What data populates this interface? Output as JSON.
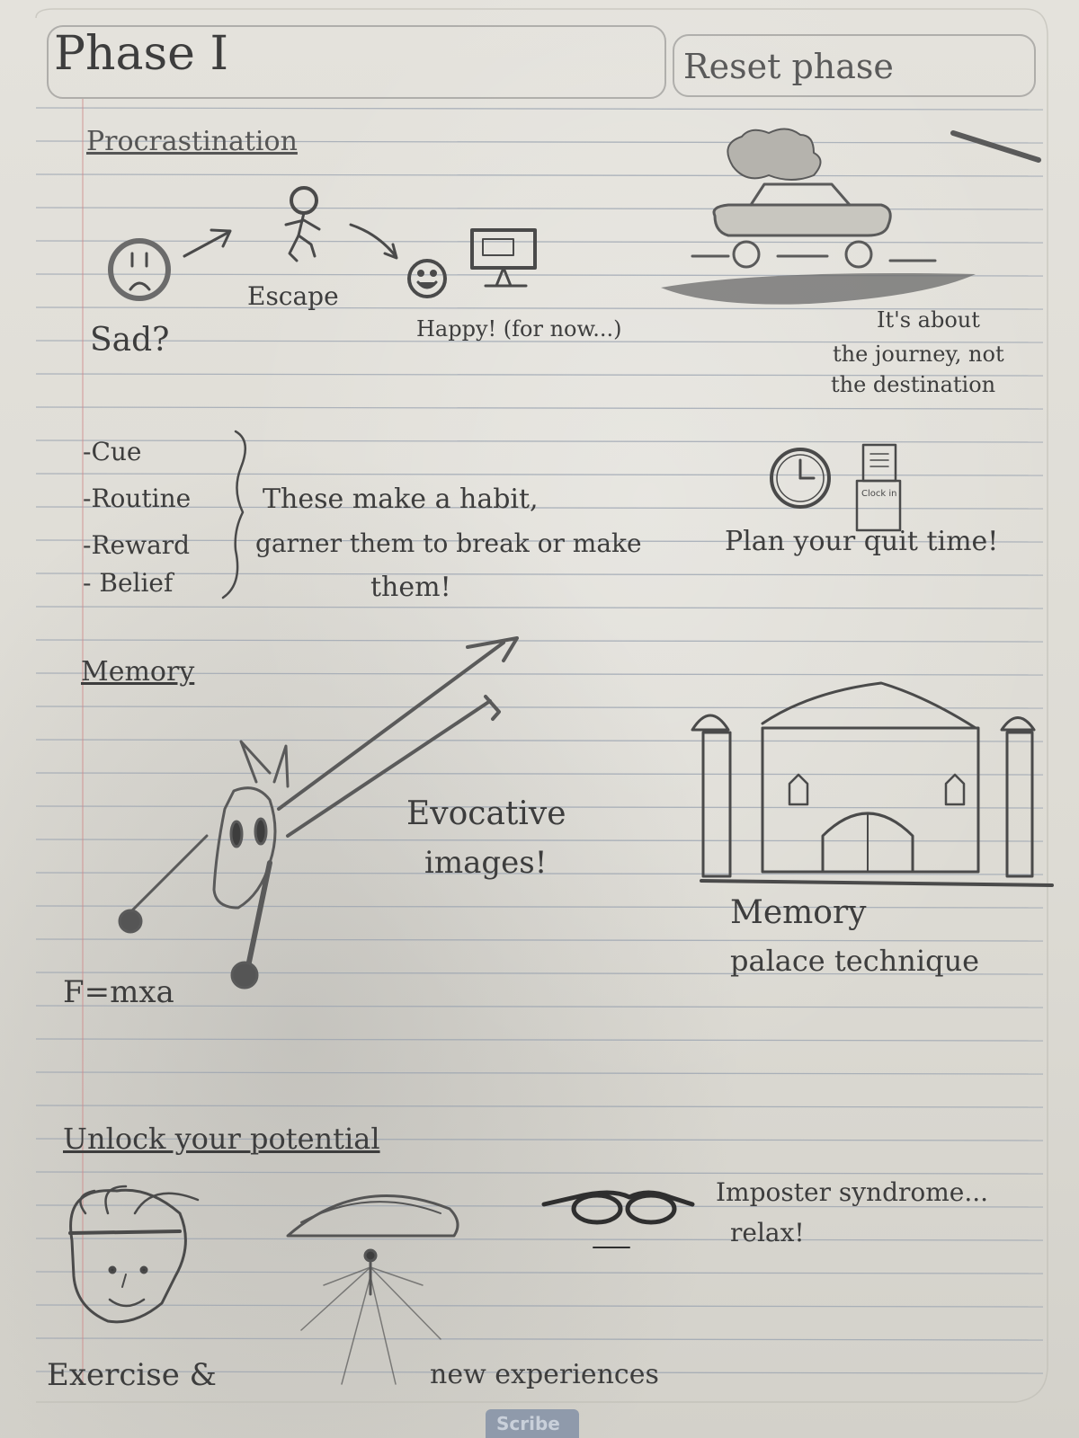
{
  "header": {
    "title": "Phase I",
    "subtitle": "Reset phase"
  },
  "procrastination": {
    "heading": "Procrastination",
    "sad": "Sad?",
    "escape": "Escape",
    "happy": "Happy! (for now...)",
    "journey_1": "It's about",
    "journey_2": "the journey, not",
    "journey_3": "the destination"
  },
  "habit": {
    "items": [
      "-Cue",
      "-Routine",
      "-Reward",
      "- Belief"
    ],
    "note_1": "These make a habit,",
    "note_2": "garner them to break or make",
    "note_3": "them!",
    "quit": "Plan your quit time!",
    "sign": "Clock in"
  },
  "memory": {
    "heading": "Memory",
    "evocative_1": "Evocative",
    "evocative_2": "images!",
    "formula": "F=mxa",
    "palace_1": "Memory",
    "palace_2": "palace technique"
  },
  "potential": {
    "heading": "Unlock your potential",
    "imposter_1": "Imposter syndrome...",
    "imposter_2": "relax!",
    "exercise": "Exercise &",
    "experiences": "new experiences"
  },
  "footer": {
    "label": "Scribe"
  },
  "colors": {
    "ink": "#3d3d3d",
    "rule": "#9aa3b0",
    "margin": "#d08a8a",
    "paper": "#e2e0d9"
  }
}
